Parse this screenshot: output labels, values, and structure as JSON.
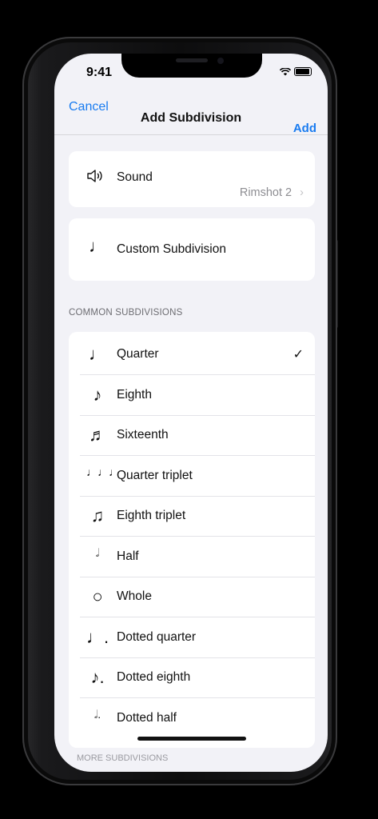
{
  "status_bar": {
    "time": "9:41"
  },
  "nav": {
    "cancel": "Cancel",
    "title": "Add Subdivision",
    "add": "Add"
  },
  "sound": {
    "icon": "speaker-icon",
    "label": "Sound",
    "value": "Rimshot 2",
    "chevron": "›"
  },
  "custom": {
    "icon": "quarter-note-icon",
    "label": "Custom Subdivision"
  },
  "common": {
    "header": "COMMON SUBDIVISIONS",
    "items": [
      {
        "glyph": "♩",
        "icon": "quarter-note-icon",
        "label": "Quarter",
        "checked": true
      },
      {
        "glyph": "♪",
        "icon": "eighth-note-icon",
        "label": "Eighth"
      },
      {
        "glyph": "♬",
        "icon": "sixteenth-note-icon",
        "label": "Sixteenth"
      },
      {
        "glyph": "♩♩♩",
        "icon": "quarter-triplet-icon",
        "label": "Quarter triplet"
      },
      {
        "glyph": "♫",
        "icon": "eighth-triplet-icon",
        "label": "Eighth triplet"
      },
      {
        "glyph": "𝅗𝅥",
        "icon": "half-note-icon",
        "label": "Half"
      },
      {
        "glyph": "○",
        "icon": "whole-note-icon",
        "label": "Whole"
      },
      {
        "glyph": "♩.",
        "icon": "dotted-quarter-icon",
        "label": "Dotted quarter"
      },
      {
        "glyph": "♪.",
        "icon": "dotted-eighth-icon",
        "label": "Dotted eighth"
      },
      {
        "glyph": "𝅗𝅥.",
        "icon": "dotted-half-icon",
        "label": "Dotted half"
      }
    ],
    "check_glyph": "✓"
  },
  "next_section": {
    "header": "MORE SUBDIVISIONS"
  },
  "colors": {
    "accent": "#1a7cf0",
    "background": "#f2f2f7",
    "card": "#ffffff",
    "secondary_text": "#8e8e93"
  }
}
